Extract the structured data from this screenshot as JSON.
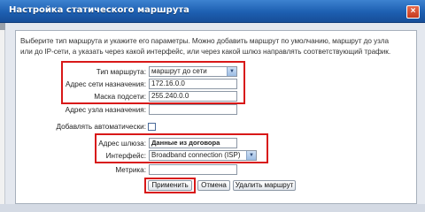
{
  "window": {
    "title": "Настройка статического маршрута",
    "close_glyph": "×"
  },
  "description": "Выберите тип маршрута и укажите его параметры. Можно добавить маршрут по умолчанию, маршрут до узла или до IP-сети, а указать через какой интерфейс, или через какой шлюз направлять соответствующий трафик.",
  "form": {
    "route_type_label": "Тип маршрута:",
    "route_type_value": "маршрут до сети",
    "dest_net_label": "Адрес сети назначения:",
    "dest_net_value": "172.16.0.0",
    "mask_label": "Маска подсети:",
    "mask_value": "255.240.0.0",
    "dest_host_label": "Адрес узла назначения:",
    "dest_host_value": "",
    "auto_add_label": "Добавлять автоматически:",
    "auto_add_checked": false,
    "gateway_label": "Адрес шлюза:",
    "gateway_value": "Данные из договора",
    "interface_label": "Интерфейс:",
    "interface_value": "Broadband connection (ISP)",
    "metric_label": "Метрика:",
    "metric_value": ""
  },
  "buttons": {
    "apply": "Применить",
    "cancel": "Отмена",
    "delete": "Удалить маршрут"
  },
  "colors": {
    "title_bar": "#1d5fb1",
    "highlight": "#d81818",
    "close_button": "#c63a1d"
  }
}
